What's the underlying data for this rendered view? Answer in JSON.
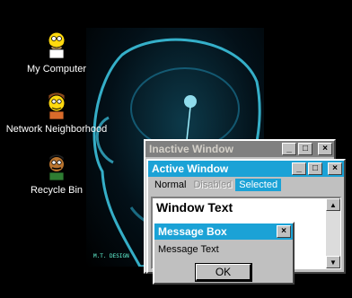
{
  "desktop": {
    "icons": [
      {
        "label": "My Computer",
        "icon": "homer-icon"
      },
      {
        "label": "Network Neighborhood",
        "icon": "barney-icon"
      },
      {
        "label": "Recycle Bin",
        "icon": "apu-icon"
      }
    ],
    "wallpaper_caption": "M.T. DESIGN"
  },
  "inactive_window": {
    "title": "Inactive Window",
    "buttons": {
      "minimize": "_",
      "maximize": "□",
      "close": "×"
    }
  },
  "active_window": {
    "title": "Active Window",
    "buttons": {
      "minimize": "_",
      "maximize": "□",
      "close": "×"
    },
    "menu": {
      "normal": "Normal",
      "disabled": "Disabled",
      "selected": "Selected"
    },
    "window_text": "Window Text",
    "scroll": {
      "up": "▲",
      "down": "▼"
    }
  },
  "message_box": {
    "title": "Message Box",
    "close": "×",
    "text": "Message Text",
    "ok_label": "OK"
  },
  "colors": {
    "active_title": "#1ba2d6",
    "inactive_title": "#808080",
    "face": "#c0c0c0",
    "desktop": "#000000"
  }
}
